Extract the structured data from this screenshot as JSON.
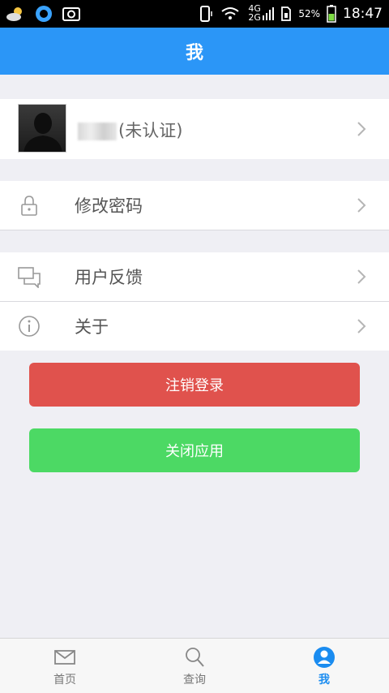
{
  "status_bar": {
    "battery": "52%",
    "time": "18:47",
    "network_top": "4G",
    "network_bottom": "2G"
  },
  "header": {
    "title": "我"
  },
  "profile": {
    "name_suffix": "(未认证)"
  },
  "menu": {
    "change_password": "修改密码",
    "feedback": "用户反馈",
    "about": "关于"
  },
  "buttons": {
    "logout": "注销登录",
    "close_app": "关闭应用"
  },
  "tabbar": {
    "tabs": [
      {
        "label": "首页",
        "icon": "mail-icon",
        "active": false
      },
      {
        "label": "查询",
        "icon": "search-icon",
        "active": false
      },
      {
        "label": "我",
        "icon": "user-icon",
        "active": true
      }
    ]
  },
  "colors": {
    "primary": "#2b96f7",
    "logout": "#e0524d",
    "close": "#4cd964",
    "active_tab": "#1a8cf0"
  }
}
